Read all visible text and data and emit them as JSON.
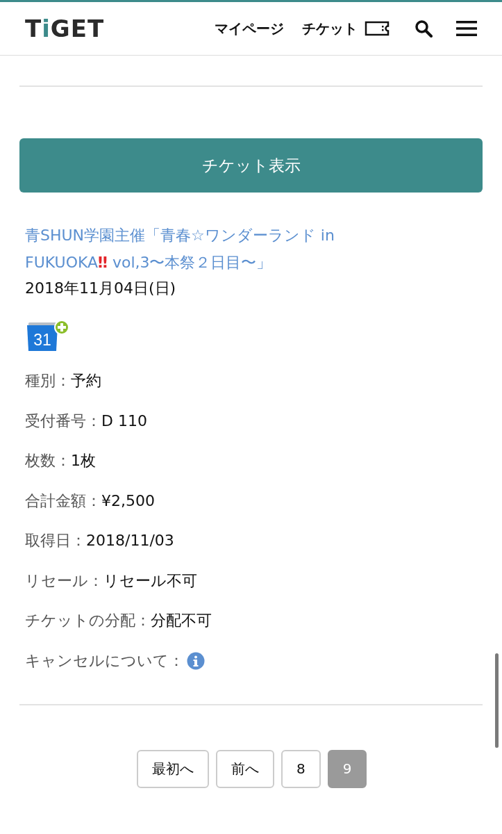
{
  "header": {
    "logo": "TiGET",
    "nav": [
      "マイページ",
      "チケット"
    ]
  },
  "show_ticket_button": "チケット表示",
  "event": {
    "title_parts": [
      "青SHUN学園主催「青春☆ワンダーランド in FUKUOKA",
      "‼",
      " vol,3〜本祭２日目〜」"
    ],
    "date": "2018年11月04日(日)",
    "calendar_day": "31"
  },
  "fields": [
    {
      "kind": "text",
      "label": "種別：",
      "value": "予約"
    },
    {
      "kind": "text",
      "label": "受付番号：",
      "value": "D 110"
    },
    {
      "kind": "text",
      "label": "枚数：",
      "value": "1枚"
    },
    {
      "kind": "text",
      "label": "合計金額：",
      "value": "¥2,500"
    },
    {
      "kind": "text",
      "label": "取得日：",
      "value": "2018/11/03"
    },
    {
      "kind": "text",
      "label": "リセール：",
      "value": "リセール不可"
    },
    {
      "kind": "text",
      "label": "チケットの分配：",
      "value": "分配不可"
    },
    {
      "kind": "info",
      "label": "キャンセルについて："
    }
  ],
  "pagination": [
    {
      "label": "最初へ",
      "selected": false
    },
    {
      "label": "前へ",
      "selected": false
    },
    {
      "label": "8",
      "selected": false
    },
    {
      "label": "9",
      "selected": true
    }
  ]
}
